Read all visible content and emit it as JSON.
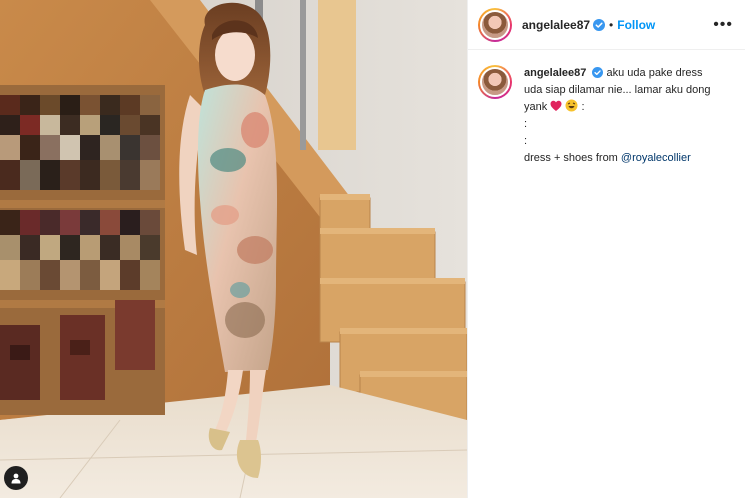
{
  "post": {
    "username": "angelalee87",
    "dot": "•",
    "follow_label": "Follow",
    "more_label": "•••"
  },
  "caption": {
    "username": "angelalee87",
    "line1": "aku uda pake dress",
    "line2": "uda siap dilamar nie... lamar aku dong",
    "line3_prefix": "yank",
    "line3_suffix": ":",
    "line4": ":",
    "line5": ":",
    "line6_prefix": "dress + shoes from",
    "mention": "@royalecollier"
  },
  "icons": {
    "verified": "verified-badge-icon",
    "heart": "red-heart-emoji",
    "laughing": "rolling-laughing-emoji",
    "user_tag": "user-tag-icon"
  },
  "colors": {
    "accent": "#0095f6",
    "verified": "#3897f0",
    "mention": "#00376b"
  }
}
